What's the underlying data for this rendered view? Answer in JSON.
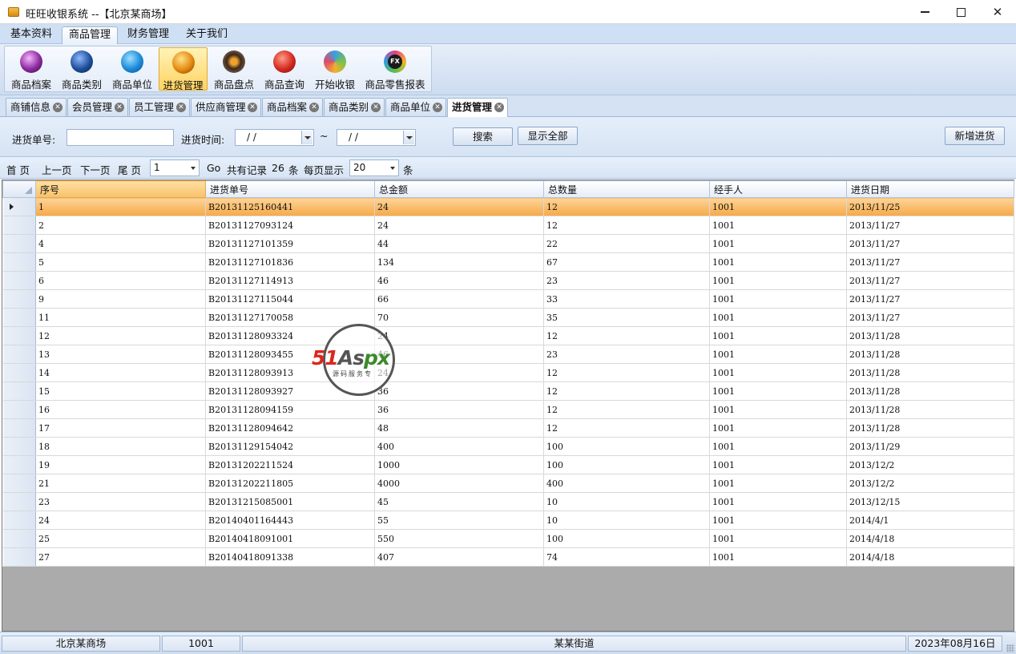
{
  "window": {
    "title": "旺旺收银系统 --【北京某商场】"
  },
  "menu": {
    "tabs": [
      "基本资料",
      "商品管理",
      "财务管理",
      "关于我们"
    ],
    "active": 1
  },
  "ribbon": {
    "buttons": [
      {
        "label": "商品档案",
        "icon": "product-file-icon"
      },
      {
        "label": "商品类别",
        "icon": "category-icon"
      },
      {
        "label": "商品单位",
        "icon": "unit-icon"
      },
      {
        "label": "进货管理",
        "icon": "purchase-icon"
      },
      {
        "label": "商品盘点",
        "icon": "inventory-icon"
      },
      {
        "label": "商品查询",
        "icon": "query-icon"
      },
      {
        "label": "开始收银",
        "icon": "cashier-icon"
      },
      {
        "label": "商品零售报表",
        "icon": "fx-report-icon",
        "icon_text": "FX"
      }
    ],
    "active": 3
  },
  "doc_tabs": [
    "商铺信息",
    "会员管理",
    "员工管理",
    "供应商管理",
    "商品档案",
    "商品类别",
    "商品单位",
    "进货管理"
  ],
  "doc_tabs_active": 7,
  "search": {
    "order_no_label": "进货单号:",
    "order_no_value": "",
    "time_label": "进货时间:",
    "date_from": "/   /",
    "tilde": "~",
    "date_to": "/   /",
    "search_button": "搜索",
    "show_all_button": "显示全部",
    "add_button": "新增进货"
  },
  "pager": {
    "first": "首 页",
    "prev": "上一页",
    "next": "下一页",
    "last": "尾 页",
    "page": "1",
    "go": "Go",
    "total_prefix": "共有记录",
    "total": "26",
    "total_suffix": "条",
    "per_page_label": "每页显示",
    "per_page": "20",
    "per_page_suffix": "条"
  },
  "table": {
    "columns": [
      "序号",
      "进货单号",
      "总金额",
      "总数量",
      "经手人",
      "进货日期"
    ],
    "rows": [
      [
        "1",
        "B20131125160441",
        "24",
        "12",
        "1001",
        "2013/11/25"
      ],
      [
        "2",
        "B20131127093124",
        "24",
        "12",
        "1001",
        "2013/11/27"
      ],
      [
        "4",
        "B20131127101359",
        "44",
        "22",
        "1001",
        "2013/11/27"
      ],
      [
        "5",
        "B20131127101836",
        "134",
        "67",
        "1001",
        "2013/11/27"
      ],
      [
        "6",
        "B20131127114913",
        "46",
        "23",
        "1001",
        "2013/11/27"
      ],
      [
        "9",
        "B20131127115044",
        "66",
        "33",
        "1001",
        "2013/11/27"
      ],
      [
        "11",
        "B20131127170058",
        "70",
        "35",
        "1001",
        "2013/11/27"
      ],
      [
        "12",
        "B20131128093324",
        "24",
        "12",
        "1001",
        "2013/11/28"
      ],
      [
        "13",
        "B20131128093455",
        "46",
        "23",
        "1001",
        "2013/11/28"
      ],
      [
        "14",
        "B20131128093913",
        "24",
        "12",
        "1001",
        "2013/11/28"
      ],
      [
        "15",
        "B20131128093927",
        "36",
        "12",
        "1001",
        "2013/11/28"
      ],
      [
        "16",
        "B20131128094159",
        "36",
        "12",
        "1001",
        "2013/11/28"
      ],
      [
        "17",
        "B20131128094642",
        "48",
        "12",
        "1001",
        "2013/11/28"
      ],
      [
        "18",
        "B20131129154042",
        "400",
        "100",
        "1001",
        "2013/11/29"
      ],
      [
        "19",
        "B20131202211524",
        "1000",
        "100",
        "1001",
        "2013/12/2"
      ],
      [
        "21",
        "B20131202211805",
        "4000",
        "400",
        "1001",
        "2013/12/2"
      ],
      [
        "23",
        "B20131215085001",
        "45",
        "10",
        "1001",
        "2013/12/15"
      ],
      [
        "24",
        "B20140401164443",
        "55",
        "10",
        "1001",
        "2014/4/1"
      ],
      [
        "25",
        "B20140418091001",
        "550",
        "100",
        "1001",
        "2014/4/18"
      ],
      [
        "27",
        "B20140418091338",
        "407",
        "74",
        "1001",
        "2014/4/18"
      ]
    ],
    "selected_row": 0
  },
  "watermark": {
    "logo": "51Aspx",
    "sub": "源码服务专"
  },
  "status": {
    "shop": "北京某商场",
    "user": "1001",
    "address": "某某街道",
    "date": "2023年08月16日"
  }
}
